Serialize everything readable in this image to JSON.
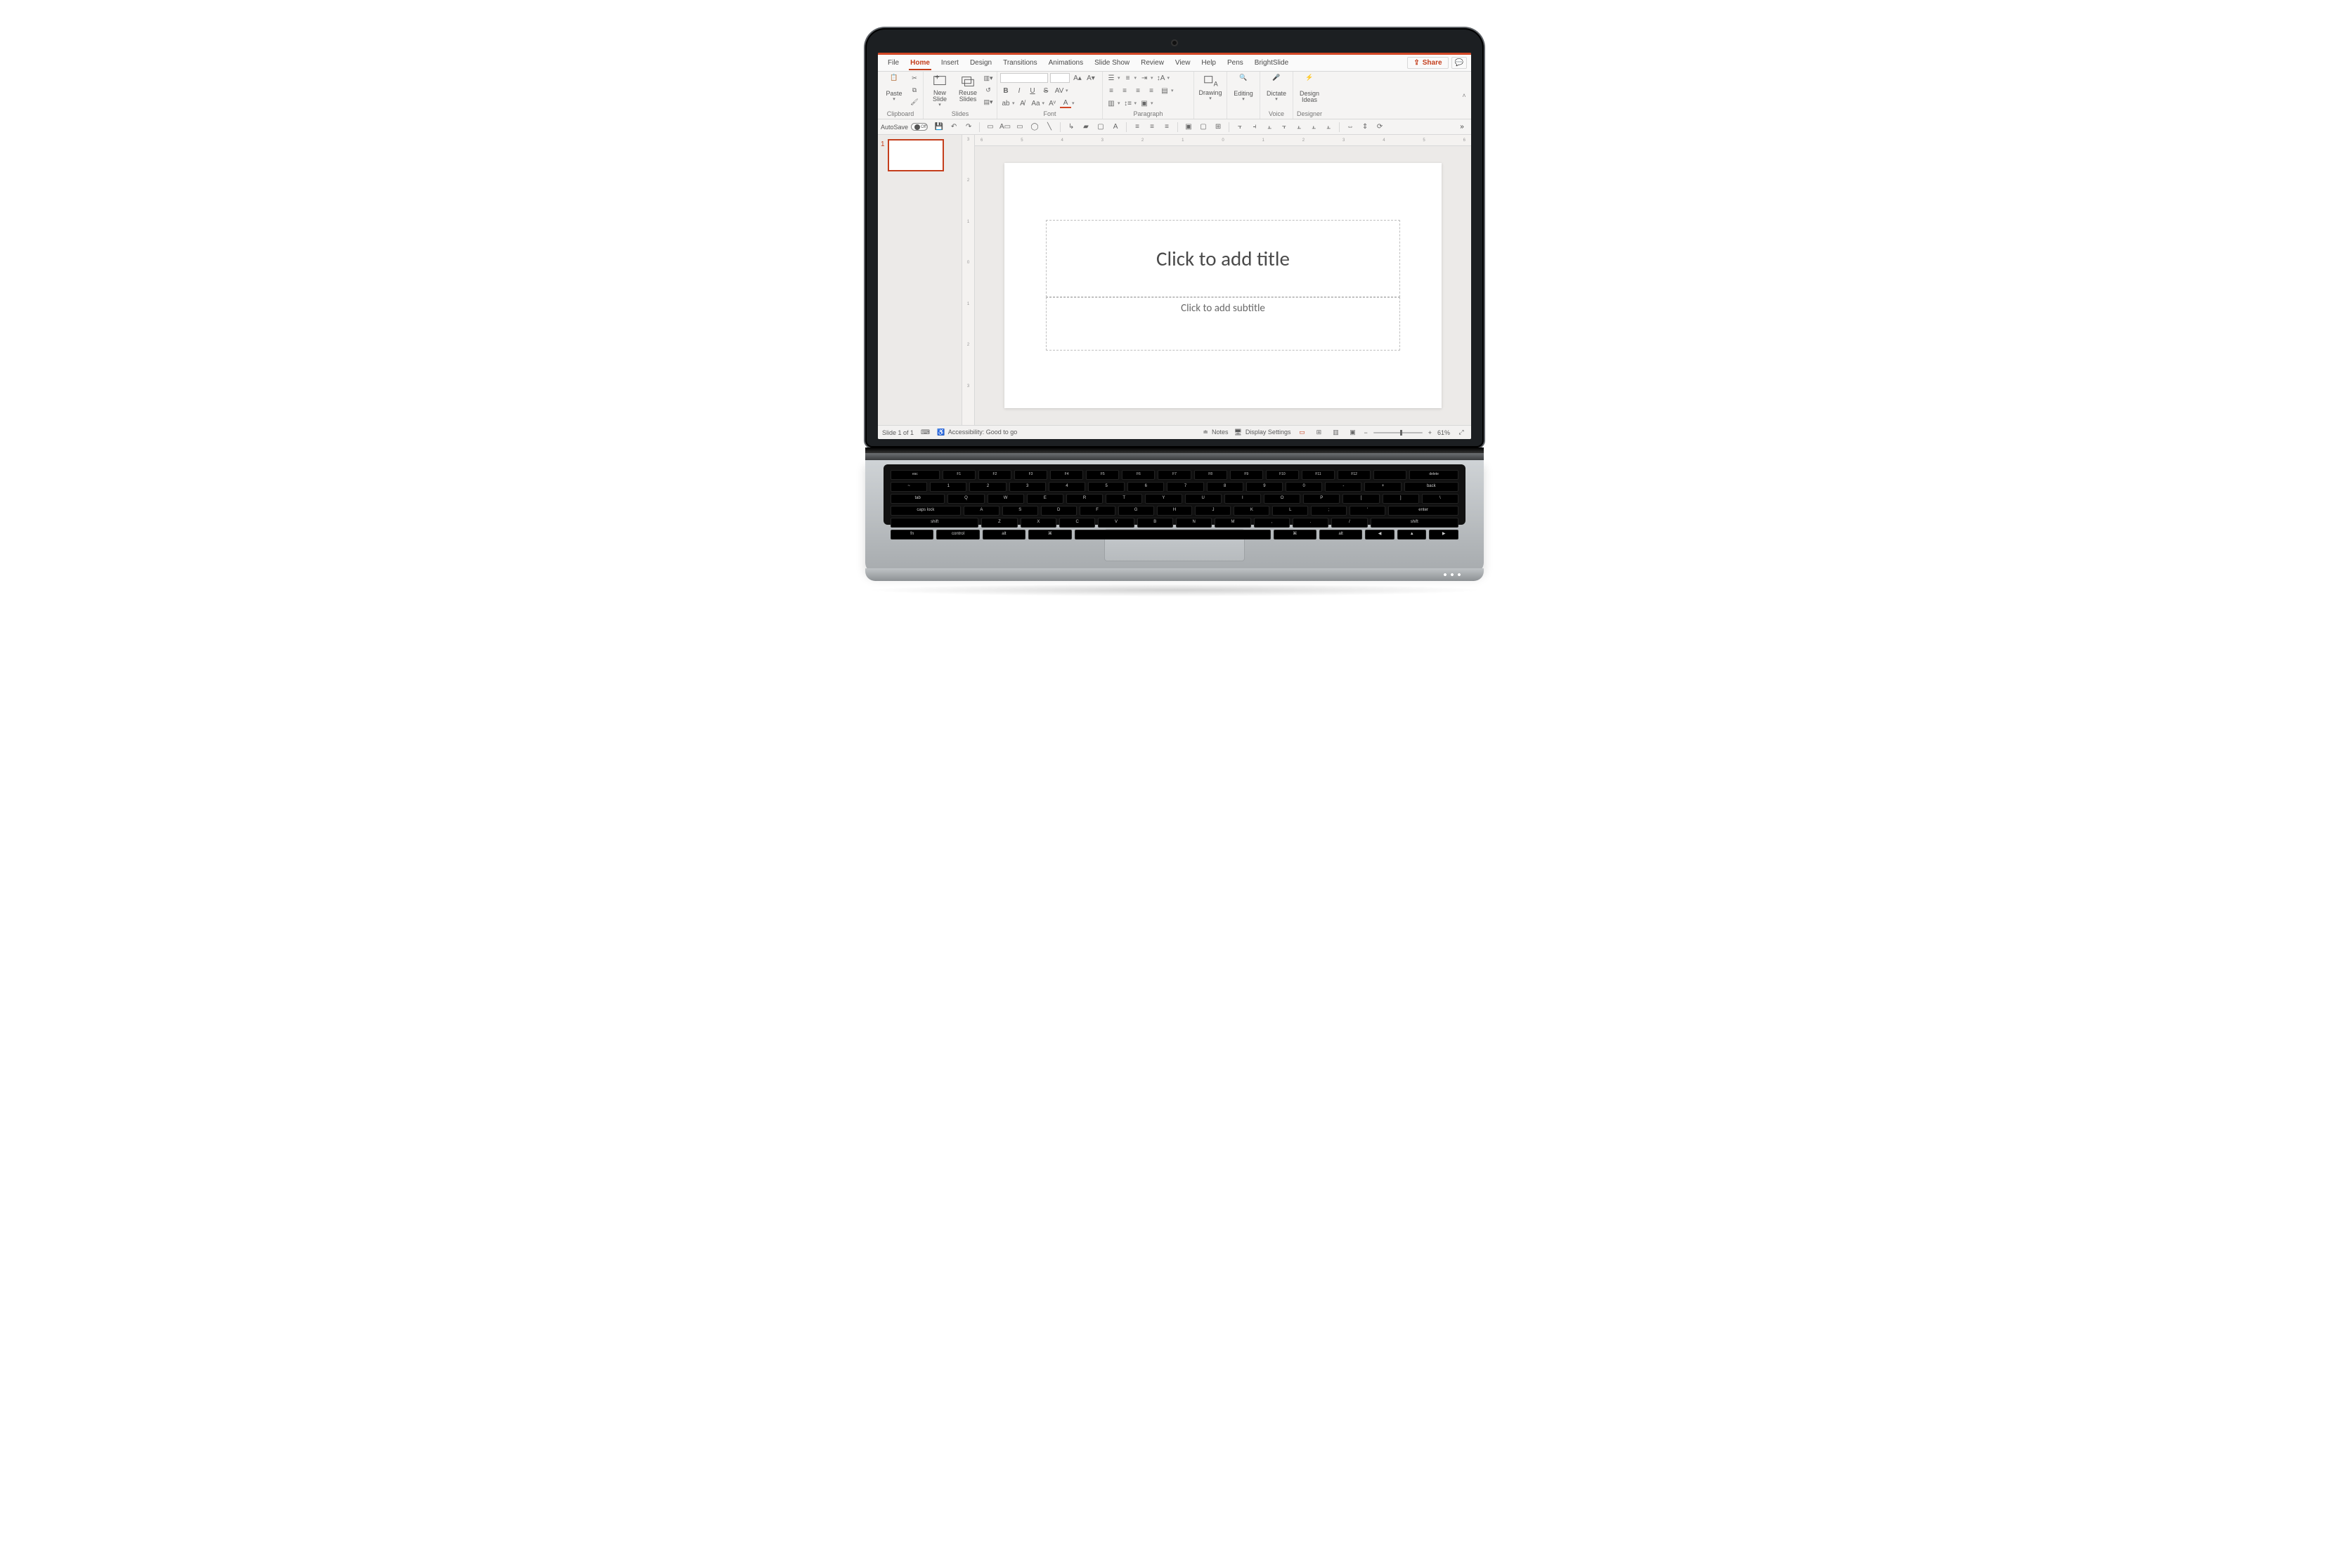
{
  "menubar": {
    "tabs": [
      "File",
      "Home",
      "Insert",
      "Design",
      "Transitions",
      "Animations",
      "Slide Show",
      "Review",
      "View",
      "Help",
      "Pens",
      "BrightSlide"
    ],
    "active_index": 1,
    "share_label": "Share"
  },
  "ribbon": {
    "groups": {
      "clipboard": {
        "label": "Clipboard",
        "paste": "Paste"
      },
      "slides": {
        "label": "Slides",
        "new": "New\nSlide",
        "reuse": "Reuse\nSlides"
      },
      "font": {
        "label": "Font",
        "b": "B",
        "i": "I",
        "u": "U",
        "s": "S",
        "av": "AV"
      },
      "paragraph": {
        "label": "Paragraph"
      },
      "drawing": {
        "label": "",
        "btn": "Drawing"
      },
      "editing": {
        "label": "",
        "btn": "Editing"
      },
      "voice": {
        "label": "Voice",
        "btn": "Dictate"
      },
      "designer": {
        "label": "Designer",
        "btn": "Design\nIdeas"
      }
    }
  },
  "qat": {
    "autosave_label": "AutoSave",
    "autosave_state": "Off"
  },
  "thumbs": {
    "current": "1"
  },
  "hruler_ticks": [
    "6",
    "5",
    "4",
    "3",
    "2",
    "1",
    "0",
    "1",
    "2",
    "3",
    "4",
    "5",
    "6"
  ],
  "vruler_ticks": [
    "3",
    "2",
    "1",
    "0",
    "1",
    "2",
    "3"
  ],
  "slide": {
    "title_placeholder": "Click to add title",
    "subtitle_placeholder": "Click to add subtitle"
  },
  "status": {
    "slide_counter": "Slide 1 of 1",
    "accessibility": "Accessibility: Good to go",
    "notes": "Notes",
    "display": "Display Settings",
    "zoom": "61%"
  },
  "keyboard": {
    "fn": [
      "esc",
      "F1",
      "F2",
      "F3",
      "F4",
      "F5",
      "F6",
      "F7",
      "F8",
      "F9",
      "F10",
      "F11",
      "F12",
      "",
      "delete"
    ],
    "r1": [
      "~",
      "1",
      "2",
      "3",
      "4",
      "5",
      "6",
      "7",
      "8",
      "9",
      "0",
      "-",
      "+",
      "back"
    ],
    "r2": [
      "tab",
      "Q",
      "W",
      "E",
      "R",
      "T",
      "Y",
      "U",
      "I",
      "O",
      "P",
      "[",
      "]",
      "\\"
    ],
    "r3": [
      "caps lock",
      "A",
      "S",
      "D",
      "F",
      "G",
      "H",
      "J",
      "K",
      "L",
      ";",
      "'",
      "enter"
    ],
    "r4": [
      "shift",
      "Z",
      "X",
      "C",
      "V",
      "B",
      "N",
      "M",
      ",",
      ".",
      "/",
      "shift"
    ],
    "r5": [
      "fn",
      "control",
      "alt",
      "⌘",
      "",
      "⌘",
      "alt",
      "◀",
      "▲",
      "▶"
    ]
  }
}
